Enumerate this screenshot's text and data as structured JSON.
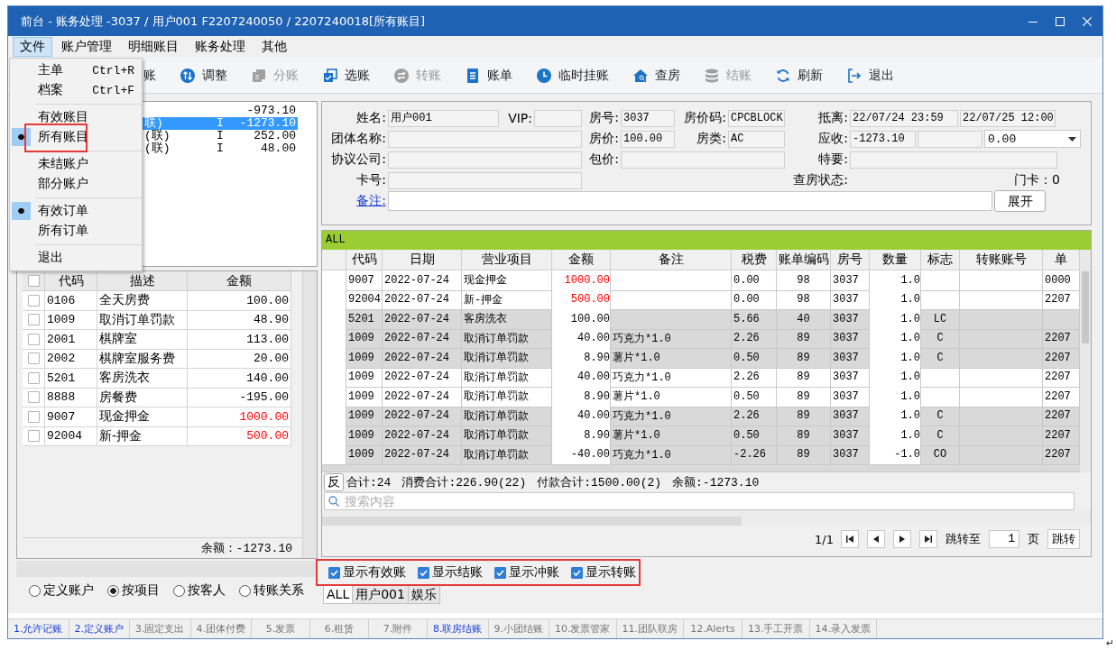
{
  "window": {
    "title": "前台 - 账务处理 -3037 / 用户001 F2207240050 / 2207240018[所有账目]"
  },
  "menu_bar": [
    {
      "label": "文件",
      "selected": true
    },
    {
      "label": "账户管理",
      "selected": false
    },
    {
      "label": "明细账目",
      "selected": false
    },
    {
      "label": "账务处理",
      "selected": false
    },
    {
      "label": "其他",
      "selected": false
    }
  ],
  "file_menu": [
    {
      "kind": "item",
      "label": "主单",
      "shortcut": "Ctrl+R",
      "checked": false,
      "highlighted": false
    },
    {
      "kind": "item",
      "label": "档案",
      "shortcut": "Ctrl+F",
      "checked": false,
      "highlighted": false
    },
    {
      "kind": "separator"
    },
    {
      "kind": "item",
      "label": "有效账目",
      "checked": false,
      "highlighted": false
    },
    {
      "kind": "item",
      "label": "所有账目",
      "checked": true,
      "highlighted": true
    },
    {
      "kind": "separator"
    },
    {
      "kind": "item",
      "label": "未结账户",
      "checked": false,
      "highlighted": false
    },
    {
      "kind": "item",
      "label": "部分账户",
      "checked": false,
      "highlighted": false
    },
    {
      "kind": "separator"
    },
    {
      "kind": "item",
      "label": "有效订单",
      "checked": true,
      "highlighted": false
    },
    {
      "kind": "item",
      "label": "所有订单",
      "checked": false,
      "highlighted": false
    },
    {
      "kind": "separator"
    },
    {
      "kind": "item",
      "label": "退出",
      "checked": false,
      "highlighted": false
    }
  ],
  "toolbar": [
    {
      "label": "账",
      "disabled": false
    },
    {
      "label": "调整",
      "disabled": false
    },
    {
      "label": "分账",
      "disabled": true
    },
    {
      "label": "选账",
      "disabled": false
    },
    {
      "label": "转账",
      "disabled": true
    },
    {
      "label": "账单",
      "disabled": false
    },
    {
      "label": "临时挂账",
      "disabled": false
    },
    {
      "label": "查房",
      "disabled": false
    },
    {
      "label": "结账",
      "disabled": true
    },
    {
      "label": "刷新",
      "disabled": false
    },
    {
      "label": "退出",
      "disabled": false
    }
  ],
  "account_list": [
    {
      "amount": "-973.10",
      "selected": false
    },
    {
      "name": "联)",
      "flag": "I",
      "amount": "-1273.10",
      "selected": true
    },
    {
      "name": "(联)",
      "flag": "I",
      "amount": "252.00",
      "selected": false
    },
    {
      "name": "(联)",
      "flag": "I",
      "amount": "48.00",
      "selected": false
    }
  ],
  "item_table": {
    "header_checked": false,
    "columns": [
      "代码",
      "描述",
      "金额"
    ],
    "rows": [
      {
        "code": "0106",
        "description": "全天房费",
        "amount": "100.00",
        "checked": false
      },
      {
        "code": "1009",
        "description": "取消订单罚款",
        "amount": "48.90",
        "checked": false
      },
      {
        "code": "2001",
        "description": "棋牌室",
        "amount": "113.00",
        "checked": false
      },
      {
        "code": "2002",
        "description": "棋牌室服务费",
        "amount": "20.00",
        "checked": false
      },
      {
        "code": "5201",
        "description": "客房洗衣",
        "amount": "140.00",
        "checked": false
      },
      {
        "code": "8888",
        "description": "房餐费",
        "amount": "-195.00",
        "checked": false
      },
      {
        "code": "9007",
        "description": "现金押金",
        "amount": "1000.00",
        "checked": false,
        "color": "#ff0000"
      },
      {
        "code": "92004",
        "description": "新-押金",
        "amount": "500.00",
        "checked": false,
        "color": "#ff0000"
      }
    ],
    "balance": "余额：-1273.10"
  },
  "group_by": [
    {
      "label": "定义账户",
      "selected": false
    },
    {
      "label": "按项目",
      "selected": true
    },
    {
      "label": "按客人",
      "selected": false
    },
    {
      "label": "转账关系",
      "selected": false
    }
  ],
  "info_form": [
    [
      {
        "kind": "label",
        "text": "姓名:"
      },
      {
        "kind": "field",
        "value": "用户001"
      },
      {
        "kind": "label",
        "text": "VIP:"
      },
      {
        "kind": "field"
      },
      {
        "kind": "label",
        "text": "房号:"
      },
      {
        "kind": "field",
        "value": "3037"
      },
      {
        "kind": "label",
        "text": "房价码:"
      },
      {
        "kind": "field",
        "value": "CPCBLOCK"
      },
      {
        "kind": "label",
        "text": "抵离:"
      },
      {
        "kind": "field",
        "value": "22/07/24 23:59"
      },
      {
        "kind": "field",
        "value": "22/07/25 12:00"
      }
    ],
    [
      {
        "kind": "label",
        "text": "团体名称:"
      },
      {
        "kind": "field"
      },
      {
        "kind": "label",
        "text": "房价:"
      },
      {
        "kind": "field",
        "value": "100.00"
      },
      {
        "kind": "label",
        "text": "房类:"
      },
      {
        "kind": "field",
        "value": "AC"
      },
      {
        "kind": "label",
        "text": "应收:"
      },
      {
        "kind": "field",
        "value": "-1273.10"
      },
      {
        "kind": "field"
      },
      {
        "kind": "select",
        "value": "0.00"
      }
    ],
    [
      {
        "kind": "label",
        "text": "协议公司:"
      },
      {
        "kind": "field"
      },
      {
        "kind": "label",
        "text": "包价:"
      },
      {
        "kind": "field"
      },
      {
        "kind": "label",
        "text": "特要:"
      },
      {
        "kind": "field"
      }
    ],
    [
      {
        "kind": "label",
        "text": "卡号:"
      },
      {
        "kind": "field"
      },
      {
        "kind": "label",
        "text": "查房状态:"
      },
      {
        "kind": "label",
        "text": "门卡：0"
      }
    ],
    [
      {
        "kind": "link",
        "text": "备注:"
      },
      {
        "kind": "input"
      },
      {
        "kind": "button",
        "text": "展开"
      }
    ]
  ],
  "ledger": {
    "filter": "ALL",
    "columns": [
      "代码",
      "日期",
      "营业项目",
      "金额",
      "备注",
      "税费",
      "账单编码",
      "房号",
      "数量",
      "标志",
      "转账账号",
      "单"
    ],
    "rows": [
      {
        "code": "9007",
        "date": "2022-07-24",
        "item": "现金押金",
        "amount": "1000.00",
        "color": "#ff0000",
        "tax": "0.00",
        "bill_code": "98",
        "room": "3037",
        "qty": "1.0",
        "column_13": "0000",
        "shaded": false
      },
      {
        "code": "92004",
        "date": "2022-07-24",
        "item": "新-押金",
        "amount": "500.00",
        "color": "#ff0000",
        "tax": "0.00",
        "bill_code": "98",
        "room": "3037",
        "qty": "1.0",
        "column_13": "2207",
        "shaded": false
      },
      {
        "code": "5201",
        "date": "2022-07-24",
        "item": "客房洗衣",
        "amount": "100.00",
        "tax": "5.66",
        "bill_code": "40",
        "room": "3037",
        "qty": "1.0",
        "flag": "LC",
        "shaded": true
      },
      {
        "code": "1009",
        "date": "2022-07-24",
        "item": "取消订单罚款",
        "amount": "40.00",
        "note": "巧克力*1.0",
        "tax": "2.26",
        "bill_code": "89",
        "room": "3037",
        "qty": "1.0",
        "flag": "C",
        "column_13": "2207",
        "shaded": true
      },
      {
        "code": "1009",
        "date": "2022-07-24",
        "item": "取消订单罚款",
        "amount": "8.90",
        "note": "薯片*1.0",
        "tax": "0.50",
        "bill_code": "89",
        "room": "3037",
        "qty": "1.0",
        "flag": "C",
        "column_13": "2207",
        "shaded": true
      },
      {
        "code": "1009",
        "date": "2022-07-24",
        "item": "取消订单罚款",
        "amount": "40.00",
        "note": "巧克力*1.0",
        "tax": "2.26",
        "bill_code": "89",
        "room": "3037",
        "qty": "1.0",
        "column_13": "2207",
        "shaded": false
      },
      {
        "code": "1009",
        "date": "2022-07-24",
        "item": "取消订单罚款",
        "amount": "8.90",
        "note": "薯片*1.0",
        "tax": "0.50",
        "bill_code": "89",
        "room": "3037",
        "qty": "1.0",
        "column_13": "2207",
        "shaded": false
      },
      {
        "code": "1009",
        "date": "2022-07-24",
        "item": "取消订单罚款",
        "amount": "40.00",
        "note": "巧克力*1.0",
        "tax": "2.26",
        "bill_code": "89",
        "room": "3037",
        "qty": "1.0",
        "flag": "C",
        "column_13": "2207",
        "shaded": true
      },
      {
        "code": "1009",
        "date": "2022-07-24",
        "item": "取消订单罚款",
        "amount": "8.90",
        "note": "薯片*1.0",
        "tax": "0.50",
        "bill_code": "89",
        "room": "3037",
        "qty": "1.0",
        "flag": "C",
        "column_13": "2207",
        "shaded": true
      },
      {
        "code": "1009",
        "date": "2022-07-24",
        "item": "取消订单罚款",
        "amount": "-40.00",
        "note": "巧克力*1.0",
        "tax": "-2.26",
        "bill_code": "89",
        "room": "3037",
        "qty": "-1.0",
        "flag": "CO",
        "column_13": "2207",
        "shaded": true
      }
    ],
    "reverse_button": "反",
    "count": "合计:24",
    "consumption": "消费合计:226.90(22)",
    "payment": "付款合计:1500.00(2)",
    "balance": "余额:-1273.10",
    "search": {
      "placeholder": "搜索内容"
    },
    "pager": {
      "page": "1/1",
      "goto_label": "跳转至",
      "page_input": "1",
      "page_unit": "页",
      "goto_button": "跳转"
    }
  },
  "display_options": {
    "highlighted": true,
    "options": [
      {
        "label": "显示有效账",
        "checked": true
      },
      {
        "label": "显示结账",
        "checked": true
      },
      {
        "label": "显示冲账",
        "checked": true
      },
      {
        "label": "显示转账",
        "checked": true
      }
    ]
  },
  "account_tabs": [
    {
      "label": "ALL",
      "selected": true
    },
    {
      "label": "用户001",
      "selected": false
    },
    {
      "label": "娱乐",
      "selected": false
    }
  ],
  "function_tabs": [
    {
      "label": "1.允许记账",
      "enabled": true
    },
    {
      "label": "2.定义账户",
      "enabled": true
    },
    {
      "label": "3.固定支出",
      "enabled": false
    },
    {
      "label": "4.团体付费",
      "enabled": false
    },
    {
      "label": "5.发票",
      "enabled": false
    },
    {
      "label": "6.租赁",
      "enabled": false
    },
    {
      "label": "7.附件",
      "enabled": false
    },
    {
      "label": "8.联房结账",
      "enabled": true
    },
    {
      "label": "9.小团结账",
      "enabled": false
    },
    {
      "label": "10.发票管家",
      "enabled": false
    },
    {
      "label": "11.团队联房",
      "enabled": false
    },
    {
      "label": "12.Alerts",
      "enabled": false
    },
    {
      "label": "13.手工开票",
      "enabled": false
    },
    {
      "label": "14.录入发票",
      "enabled": false
    }
  ],
  "page_mark": "↵"
}
